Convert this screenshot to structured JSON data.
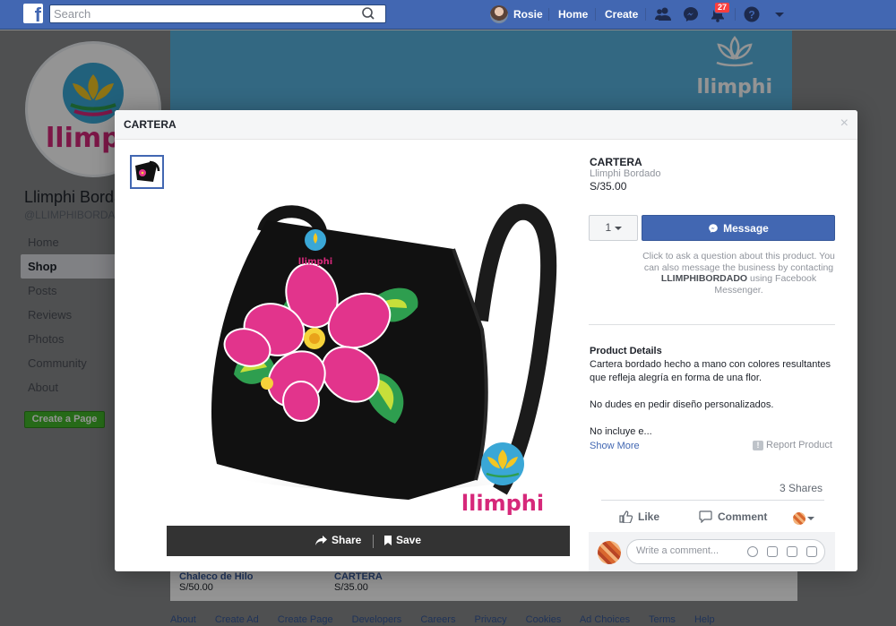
{
  "topbar": {
    "logo_letter": "f",
    "search_placeholder": "Search",
    "user_name": "Rosie",
    "home_label": "Home",
    "create_label": "Create",
    "notifications_count": "27"
  },
  "page": {
    "cover_logo_text": "llimphi",
    "profile_logo_text": "llimphi",
    "name": "Llimphi Bordado",
    "handle": "@LLIMPHIBORDADO",
    "nav": [
      {
        "label": "Home",
        "active": false
      },
      {
        "label": "Shop",
        "active": true
      },
      {
        "label": "Posts",
        "active": false
      },
      {
        "label": "Reviews",
        "active": false
      },
      {
        "label": "Photos",
        "active": false
      },
      {
        "label": "Community",
        "active": false
      },
      {
        "label": "About",
        "active": false
      }
    ],
    "create_page_label": "Create a Page",
    "products": [
      {
        "title": "Chaleco de Hilo",
        "price": "S/50.00"
      },
      {
        "title": "CARTERA",
        "price": "S/35.00"
      }
    ],
    "footer_links": [
      "About",
      "Create Ad",
      "Create Page",
      "Developers",
      "Careers",
      "Privacy",
      "Cookies",
      "Ad Choices",
      "Terms",
      "Help"
    ]
  },
  "modal": {
    "header_title": "CARTERA",
    "close_glyph": "×",
    "image_brand_small": "llimphi",
    "image_brand_large": "llimphi",
    "share_label": "Share",
    "save_label": "Save",
    "product": {
      "title": "CARTERA",
      "seller": "Llimphi Bordado",
      "price": "S/35.00",
      "quantity": "1",
      "message_label": "Message",
      "note_before": "Click to ask a question about this product. You can also message the business by contacting ",
      "note_business": "LLIMPHIBORDADO",
      "note_after": " using Facebook Messenger.",
      "details_heading": "Product Details",
      "details_text": "Cartera bordado hecho a mano con colores resultantes que refleja alegría en forma de una flor.\n\nNo dudes en pedir diseño personalizados.\n\nNo incluye e...",
      "show_more_label": "Show More",
      "report_label": "Report Product",
      "shares_label": "3 Shares",
      "like_label": "Like",
      "comment_label": "Comment",
      "comment_placeholder": "Write a comment..."
    }
  },
  "colors": {
    "facebook_blue": "#4267b2",
    "brand_teal": "#3aa7d6",
    "brand_pink": "#d6287a",
    "create_green": "#42b72a"
  }
}
